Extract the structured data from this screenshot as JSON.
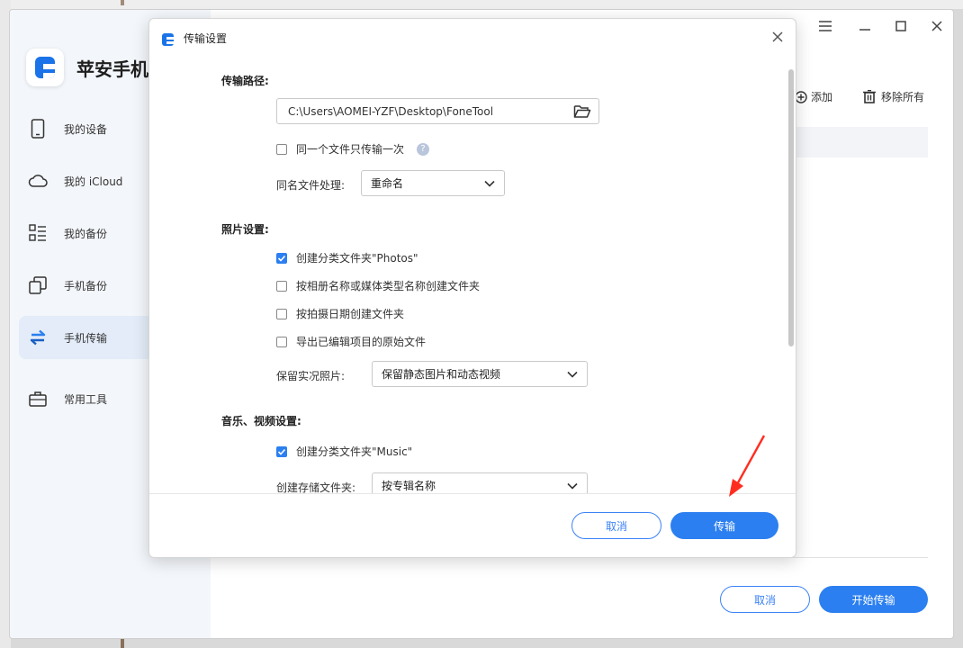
{
  "app": {
    "title": "苹安手机",
    "nav": [
      {
        "label": "我的设备",
        "icon": "phone-icon"
      },
      {
        "label": "我的 iCloud",
        "icon": "cloud-icon"
      },
      {
        "label": "我的备份",
        "icon": "list-icon"
      },
      {
        "label": "手机备份",
        "icon": "copy-icon"
      },
      {
        "label": "手机传输",
        "icon": "transfer-icon",
        "active": true
      },
      {
        "label": "常用工具",
        "icon": "toolbox-icon"
      }
    ],
    "toolbar": {
      "add_label": "添加",
      "remove_all_label": "移除所有"
    },
    "footer": {
      "cancel_label": "取消",
      "start_label": "开始传输"
    }
  },
  "dialog": {
    "title": "传输设置",
    "path_section": {
      "title": "传输路径:",
      "path_value": "C:\\Users\\AOMEI-YZF\\Desktop\\FoneTool",
      "once_label": "同一个文件只传输一次",
      "once_checked": false,
      "same_name_label": "同名文件处理:",
      "same_name_value": "重命名"
    },
    "photo_section": {
      "title": "照片设置:",
      "options": [
        {
          "label": "创建分类文件夹\"Photos\"",
          "checked": true
        },
        {
          "label": "按相册名称或媒体类型名称创建文件夹",
          "checked": false
        },
        {
          "label": "按拍摄日期创建文件夹",
          "checked": false
        },
        {
          "label": "导出已编辑项目的原始文件",
          "checked": false
        }
      ],
      "live_label": "保留实况照片:",
      "live_value": "保留静态图片和动态视频"
    },
    "media_section": {
      "title": "音乐、视频设置:",
      "options": [
        {
          "label": "创建分类文件夹\"Music\"",
          "checked": true
        }
      ],
      "folder_label": "创建存储文件夹:",
      "folder_value": "按专辑名称"
    },
    "buttons": {
      "cancel_label": "取消",
      "transfer_label": "传输"
    }
  },
  "colors": {
    "accent": "#2b7ff0",
    "annotation": "#ff2d20"
  }
}
